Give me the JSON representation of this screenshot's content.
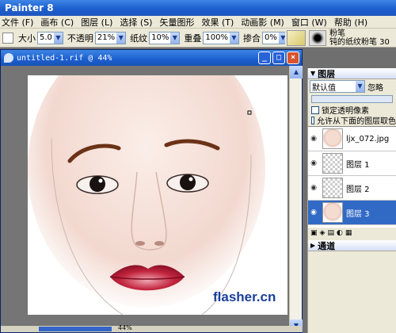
{
  "app": {
    "title": "Painter 8"
  },
  "menu": {
    "items": [
      "文件 (F)",
      "画布 (C)",
      "图层 (L)",
      "选择 (S)",
      "矢量图形",
      "效果 (T)",
      "动画影 (M)",
      "窗口 (W)",
      "帮助 (H)"
    ]
  },
  "props": {
    "size_label": "大小",
    "size_value": "5.0",
    "opacity_label": "不透明",
    "opacity_value": "21%",
    "grain_label": "纸纹",
    "grain_value": "10%",
    "resat_label": "重叠",
    "resat_value": "100%",
    "bleed_label": "掺合",
    "bleed_value": "0%",
    "jitter_label": "抖",
    "brush_category": "粉笔",
    "brush_variant": "钝的纸纹粉笔 30"
  },
  "document": {
    "title": "untitled-1.rif @ 44%",
    "watermark": "flasher.cn",
    "zoom": "44%",
    "minimize_glyph": "_",
    "maximize_glyph": "□",
    "close_glyph": "×"
  },
  "layers_panel": {
    "title": "图层",
    "composite_method": "默认值",
    "ignore_label": "忽略",
    "options": [
      "锁定透明像素",
      "允许从下面的图层取色"
    ],
    "layers": [
      {
        "name": "ljx_072.jpg",
        "selected": false,
        "thumb": "face"
      },
      {
        "name": "图层 1",
        "selected": false,
        "thumb": "empty"
      },
      {
        "name": "图层 2",
        "selected": false,
        "thumb": "empty"
      },
      {
        "name": "图层 3",
        "selected": true,
        "thumb": "face"
      }
    ]
  },
  "channels_panel": {
    "title": "通道"
  },
  "colors": {
    "titlebar": "#1c5fcf",
    "selection": "#316ac5",
    "lips": "#c2253e",
    "brow": "#6b3217",
    "watermark": "#1a3f9c"
  }
}
